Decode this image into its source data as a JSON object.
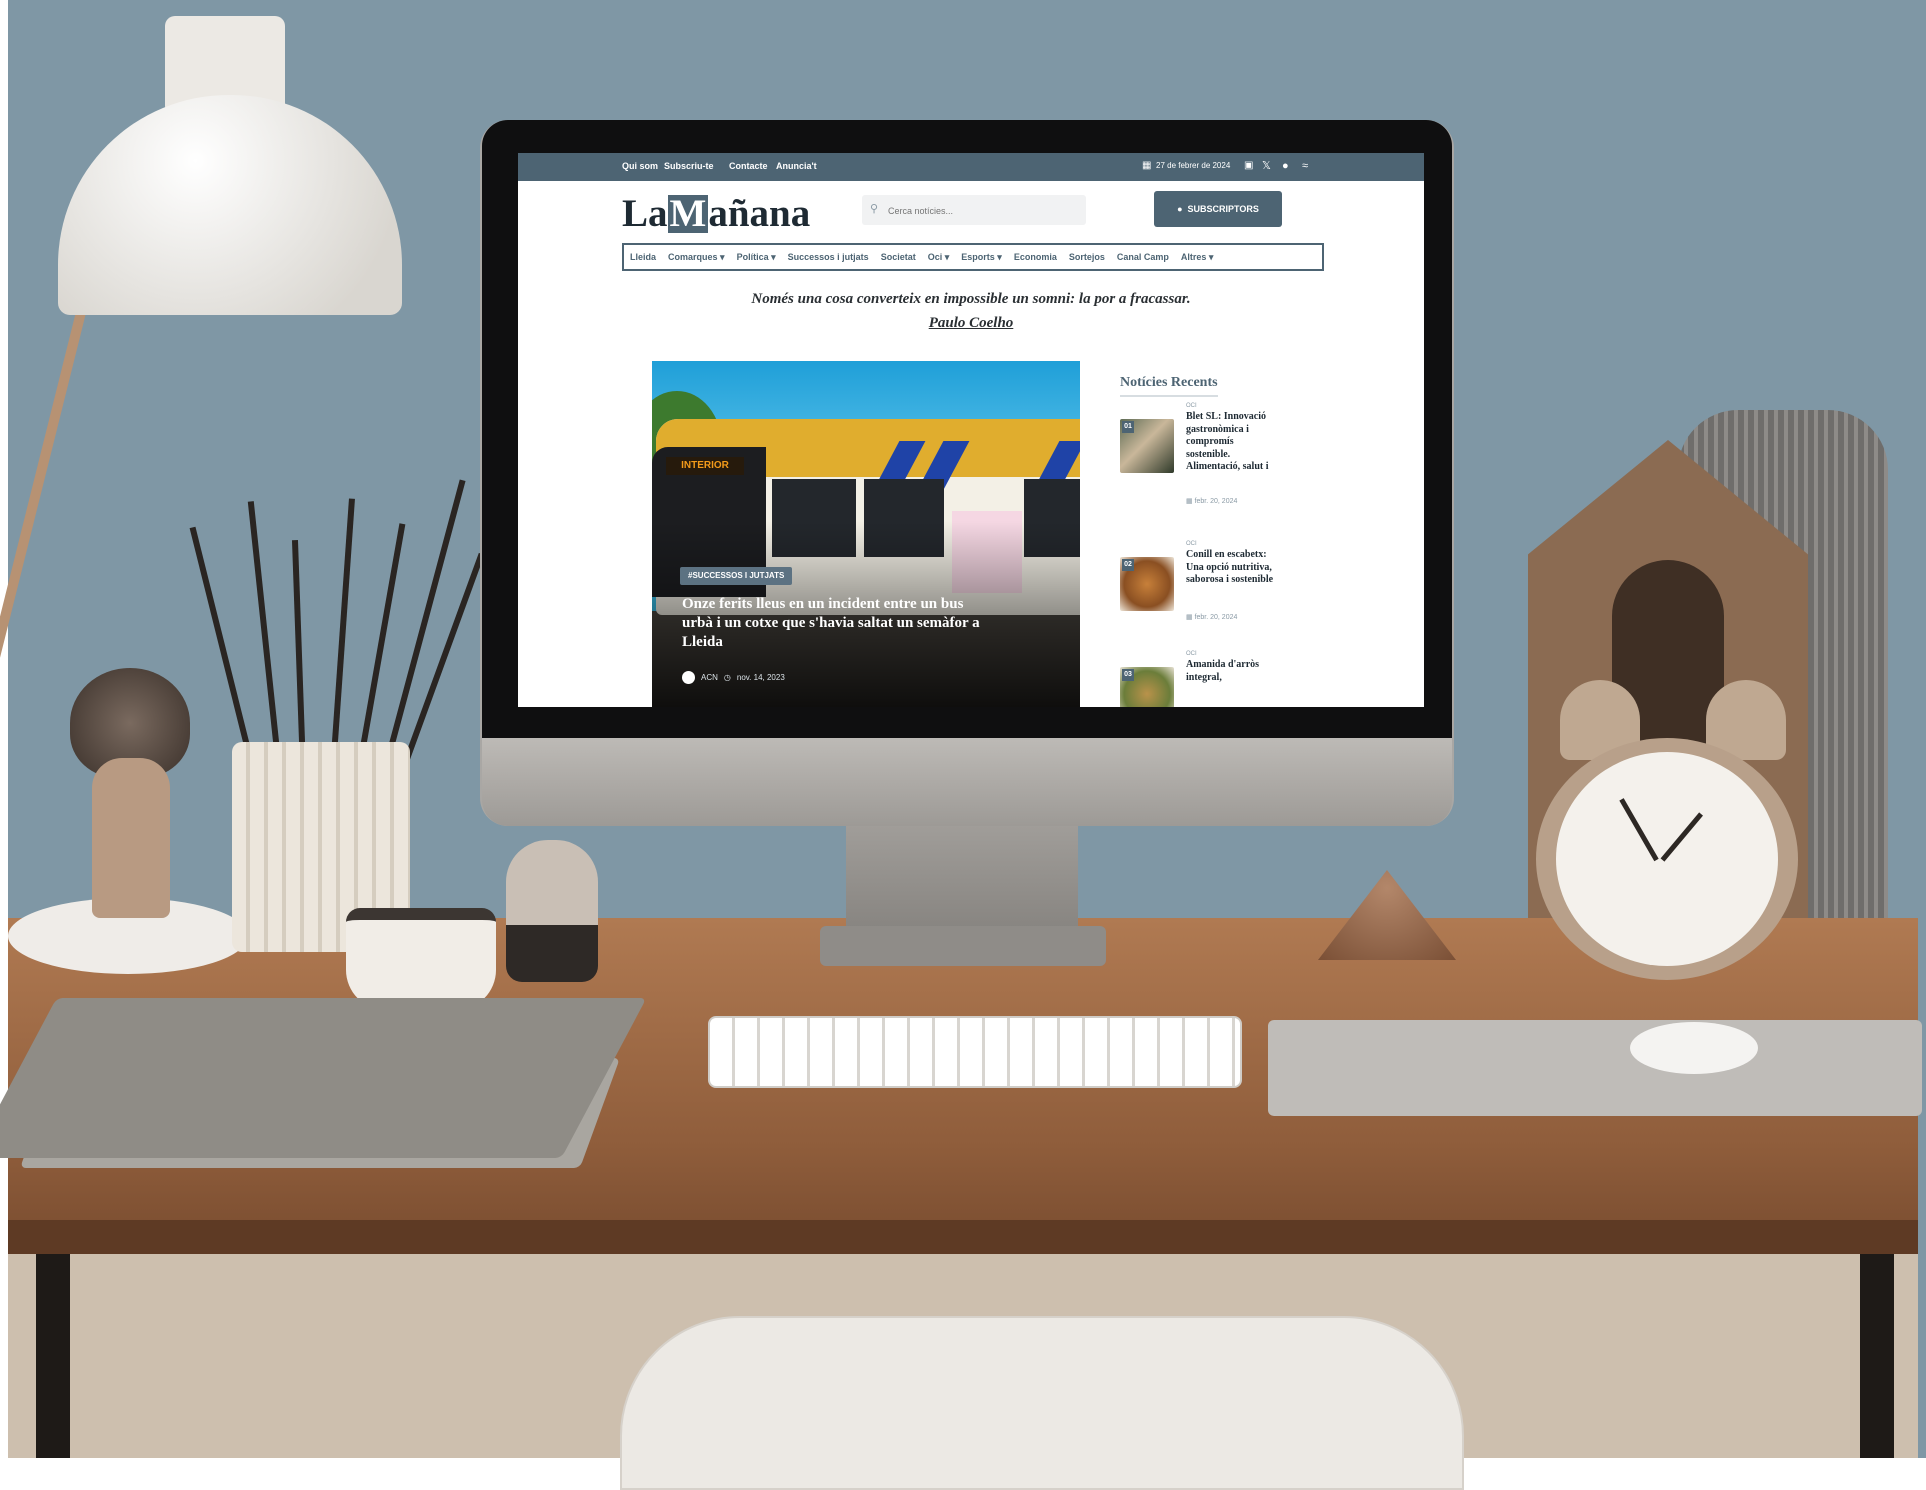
{
  "topbar": {
    "links": [
      "Qui som",
      "Subscriu-te",
      "Contacte",
      "Anuncia't"
    ],
    "date": "27 de febrer de 2024",
    "social_icons": [
      "instagram-icon",
      "x-icon",
      "facebook-icon",
      "wifi-icon"
    ]
  },
  "header": {
    "logo_before": "La",
    "logo_highlight": "M",
    "logo_after": "añana",
    "search_placeholder": "Cerca notícies...",
    "subscribers_button": "SUBSCRIPTORS"
  },
  "nav": {
    "items": [
      {
        "label": "Lleida",
        "dropdown": false
      },
      {
        "label": "Comarques",
        "dropdown": true
      },
      {
        "label": "Política",
        "dropdown": true
      },
      {
        "label": "Successos i jutjats",
        "dropdown": false
      },
      {
        "label": "Societat",
        "dropdown": false
      },
      {
        "label": "Oci",
        "dropdown": true
      },
      {
        "label": "Esports",
        "dropdown": true
      },
      {
        "label": "Economia",
        "dropdown": false
      },
      {
        "label": "Sortejos",
        "dropdown": false
      },
      {
        "label": "Canal Camp",
        "dropdown": false
      },
      {
        "label": "Altres",
        "dropdown": true
      }
    ],
    "dropdown_glyph": "▾"
  },
  "quote": {
    "text": "Només una cosa converteix en impossible un somni: la por a fracassar.",
    "author": "Paulo Coelho"
  },
  "hero": {
    "bus_display": "INTERIOR",
    "tag": "#SUCCESSOS I JUTJATS",
    "title": "Onze ferits lleus en un incident entre un bus urbà i un cotxe que s'havia saltat un semàfor a Lleida",
    "author": "ACN",
    "date": "nov. 14, 2023"
  },
  "sidebar": {
    "title": "Notícies Recents",
    "items": [
      {
        "num": "01",
        "category": "OCI",
        "title": "Blet SL: Innovació gastronòmica i compromís sostenible. Alimentació, salut i",
        "date": "febr. 20, 2024"
      },
      {
        "num": "02",
        "category": "OCI",
        "title": "Conill en escabetx: Una opció nutritiva, saborosa i sostenible",
        "date": "febr. 20, 2024"
      },
      {
        "num": "03",
        "category": "OCI",
        "title": "Amanida d'arròs integral,",
        "date": ""
      }
    ]
  },
  "colors": {
    "brand": "#4d6473",
    "wall": "#7f97a5",
    "desk": "#8f5d3b"
  }
}
